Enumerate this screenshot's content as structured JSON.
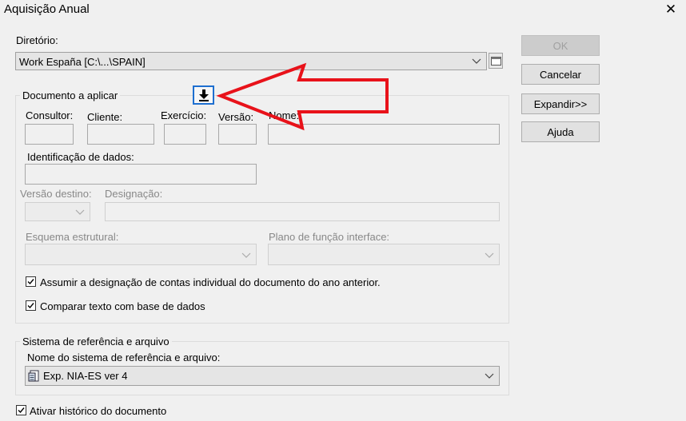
{
  "window": {
    "title": "Aquisição Anual",
    "close_glyph": "✕"
  },
  "diretorio": {
    "label": "Diretório:",
    "value": "Work España [C:\\...\\SPAIN]"
  },
  "buttons": {
    "ok": "OK",
    "cancel": "Cancelar",
    "expand": "Expandir>>",
    "help": "Ajuda"
  },
  "documento": {
    "legend": "Documento a aplicar",
    "consultor": "Consultor:",
    "cliente": "Cliente:",
    "exercicio": "Exercício:",
    "versao": "Versão:",
    "nome": "Nome:",
    "identificacao": "Identificação de dados:",
    "versao_destino": "Versão destino:",
    "designacao": "Designação:",
    "esquema": "Esquema estrutural:",
    "plano": "Plano de função interface:",
    "chk_assumir": "Assumir a designação de contas individual do documento do ano anterior.",
    "chk_comparar": "Comparar texto com base de dados"
  },
  "sistema": {
    "legend": "Sistema de referência e arquivo",
    "label": "Nome do sistema de referência e arquivo:",
    "value": "Exp. NIA-ES ver 4"
  },
  "historico": {
    "label": "Ativar histórico do documento"
  },
  "icons": [
    "download-icon",
    "browse-folder-icon",
    "chevron-down-icon",
    "checkmark-icon",
    "database-icon",
    "red-arrow-annotation"
  ],
  "colors": {
    "background": "#f0f0f0",
    "annotation_red": "#e8121a",
    "focus_blue": "#1e6fd0"
  }
}
